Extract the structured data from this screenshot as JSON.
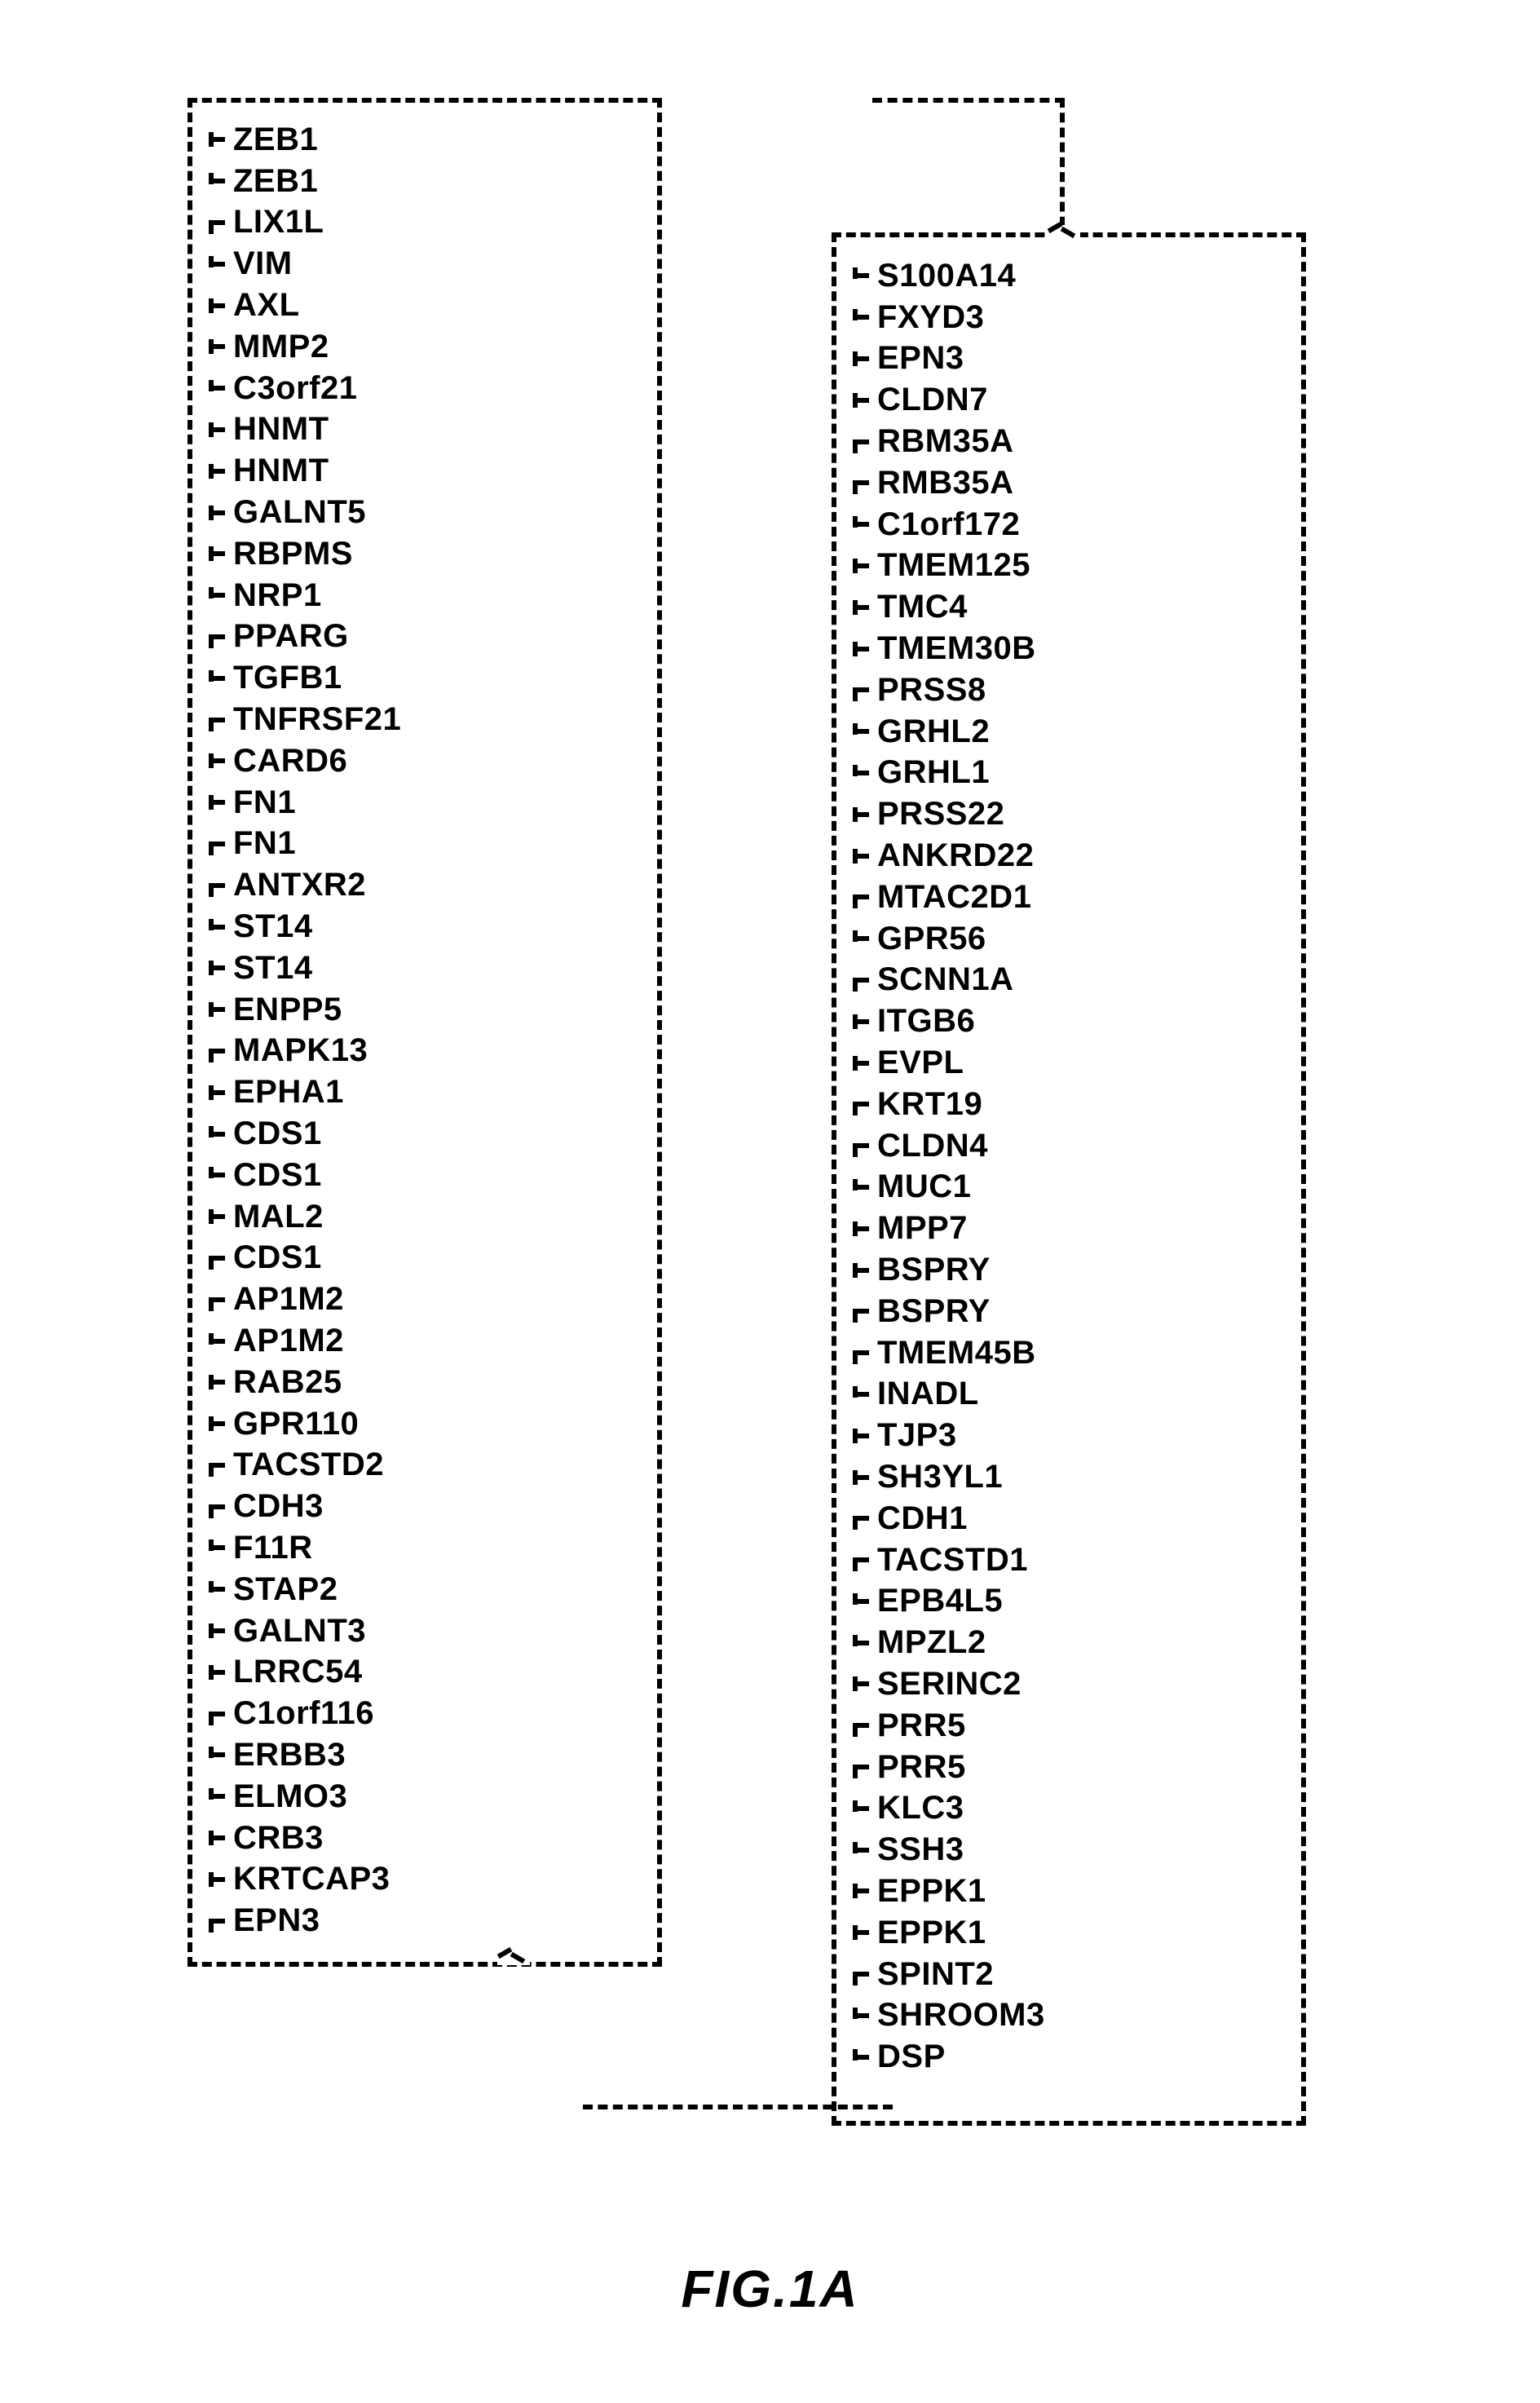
{
  "figure_label": "FIG.1A",
  "left_column": [
    {
      "label": "ZEB1",
      "tick": "center"
    },
    {
      "label": "ZEB1",
      "tick": "up"
    },
    {
      "label": "LIX1L",
      "tick": "down"
    },
    {
      "label": "VIM",
      "tick": "up"
    },
    {
      "label": "AXL",
      "tick": "center"
    },
    {
      "label": "MMP2",
      "tick": "center"
    },
    {
      "label": "C3orf21",
      "tick": "up"
    },
    {
      "label": "HNMT",
      "tick": "center"
    },
    {
      "label": "HNMT",
      "tick": "center"
    },
    {
      "label": "GALNT5",
      "tick": "center"
    },
    {
      "label": "RBPMS",
      "tick": "center"
    },
    {
      "label": "NRP1",
      "tick": "up"
    },
    {
      "label": "PPARG",
      "tick": "down"
    },
    {
      "label": "TGFB1",
      "tick": "up"
    },
    {
      "label": "TNFRSF21",
      "tick": "down"
    },
    {
      "label": "CARD6",
      "tick": "center"
    },
    {
      "label": "FN1",
      "tick": "center"
    },
    {
      "label": "FN1",
      "tick": "down"
    },
    {
      "label": "ANTXR2",
      "tick": "down"
    },
    {
      "label": "ST14",
      "tick": "up"
    },
    {
      "label": "ST14",
      "tick": "center"
    },
    {
      "label": "ENPP5",
      "tick": "center"
    },
    {
      "label": "MAPK13",
      "tick": "down"
    },
    {
      "label": "EPHA1",
      "tick": "center"
    },
    {
      "label": "CDS1",
      "tick": "up"
    },
    {
      "label": "CDS1",
      "tick": "up"
    },
    {
      "label": "MAL2",
      "tick": "center"
    },
    {
      "label": "CDS1",
      "tick": "down"
    },
    {
      "label": "AP1M2",
      "tick": "down"
    },
    {
      "label": "AP1M2",
      "tick": "up"
    },
    {
      "label": "RAB25",
      "tick": "center"
    },
    {
      "label": "GPR110",
      "tick": "center"
    },
    {
      "label": "TACSTD2",
      "tick": "down"
    },
    {
      "label": "CDH3",
      "tick": "down"
    },
    {
      "label": "F11R",
      "tick": "up"
    },
    {
      "label": "STAP2",
      "tick": "up"
    },
    {
      "label": "GALNT3",
      "tick": "center"
    },
    {
      "label": "LRRC54",
      "tick": "center"
    },
    {
      "label": "C1orf116",
      "tick": "down"
    },
    {
      "label": "ERBB3",
      "tick": "up"
    },
    {
      "label": "ELMO3",
      "tick": "up"
    },
    {
      "label": "CRB3",
      "tick": "center"
    },
    {
      "label": "KRTCAP3",
      "tick": "center"
    },
    {
      "label": "EPN3",
      "tick": "down"
    }
  ],
  "right_column": [
    {
      "label": "S100A14",
      "tick": "up"
    },
    {
      "label": "FXYD3",
      "tick": "up"
    },
    {
      "label": "EPN3",
      "tick": "center"
    },
    {
      "label": "CLDN7",
      "tick": "center"
    },
    {
      "label": "RBM35A",
      "tick": "down"
    },
    {
      "label": "RMB35A",
      "tick": "down"
    },
    {
      "label": "C1orf172",
      "tick": "up"
    },
    {
      "label": "TMEM125",
      "tick": "center"
    },
    {
      "label": "TMC4",
      "tick": "center"
    },
    {
      "label": "TMEM30B",
      "tick": "center"
    },
    {
      "label": "PRSS8",
      "tick": "down"
    },
    {
      "label": "GRHL2",
      "tick": "up"
    },
    {
      "label": "GRHL1",
      "tick": "up"
    },
    {
      "label": "PRSS22",
      "tick": "center"
    },
    {
      "label": "ANKRD22",
      "tick": "center"
    },
    {
      "label": "MTAC2D1",
      "tick": "down"
    },
    {
      "label": "GPR56",
      "tick": "up"
    },
    {
      "label": "SCNN1A",
      "tick": "down"
    },
    {
      "label": "ITGB6",
      "tick": "center"
    },
    {
      "label": "EVPL",
      "tick": "center"
    },
    {
      "label": "KRT19",
      "tick": "down"
    },
    {
      "label": "CLDN4",
      "tick": "down"
    },
    {
      "label": "MUC1",
      "tick": "up"
    },
    {
      "label": "MPP7",
      "tick": "center"
    },
    {
      "label": "BSPRY",
      "tick": "center"
    },
    {
      "label": "BSPRY",
      "tick": "down"
    },
    {
      "label": "TMEM45B",
      "tick": "down"
    },
    {
      "label": "INADL",
      "tick": "up"
    },
    {
      "label": "TJP3",
      "tick": "center"
    },
    {
      "label": "SH3YL1",
      "tick": "center"
    },
    {
      "label": "CDH1",
      "tick": "down"
    },
    {
      "label": "TACSTD1",
      "tick": "down"
    },
    {
      "label": "EPB4L5",
      "tick": "up"
    },
    {
      "label": "MPZL2",
      "tick": "up"
    },
    {
      "label": "SERINC2",
      "tick": "center"
    },
    {
      "label": "PRR5",
      "tick": "down"
    },
    {
      "label": "PRR5",
      "tick": "down"
    },
    {
      "label": "KLC3",
      "tick": "up"
    },
    {
      "label": "SSH3",
      "tick": "up"
    },
    {
      "label": "EPPK1",
      "tick": "center"
    },
    {
      "label": "EPPK1",
      "tick": "center"
    },
    {
      "label": "SPINT2",
      "tick": "down"
    },
    {
      "label": "SHROOM3",
      "tick": "up"
    },
    {
      "label": "DSP",
      "tick": "up"
    }
  ]
}
